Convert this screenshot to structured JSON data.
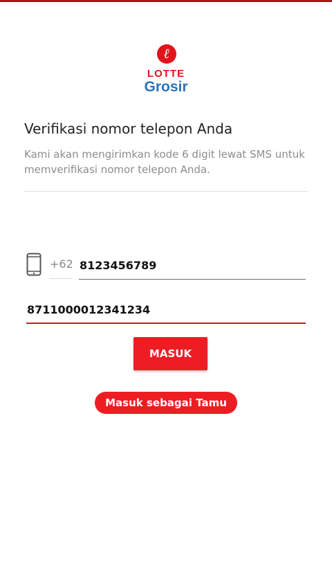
{
  "logo": {
    "brand": "LOTTE",
    "product": "Grosir",
    "emblem_glyph": "ℓ",
    "brand_color": "#e1131b",
    "product_color": "#2a73b7"
  },
  "header": {
    "title": "Verifikasi nomor telepon Anda",
    "subtitle": "Kami akan mengirimkan kode 6 digit lewat SMS untuk memverifikasi nomor telepon Anda."
  },
  "phone": {
    "icon": "smartphone-icon",
    "country_code": "+62",
    "value": "8123456789"
  },
  "code": {
    "value": "8711000012341234"
  },
  "buttons": {
    "login_label": "MASUK",
    "guest_label": "Masuk sebagai Tamu"
  },
  "colors": {
    "accent": "#ee1d23",
    "top_bar": "#b3121b",
    "muted_text": "#8c8c8c"
  }
}
